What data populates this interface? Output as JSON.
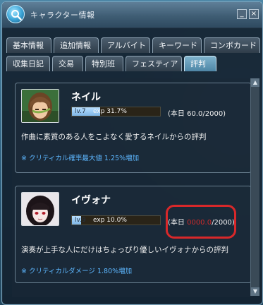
{
  "window": {
    "title": "キャラクター情報",
    "minimize_label": "_",
    "close_label": "×"
  },
  "tabs_row1": [
    "基本情報",
    "追加情報",
    "アルバイト",
    "キーワード",
    "コンボカード"
  ],
  "tabs_row2": [
    "収集日記",
    "交易",
    "特別班",
    "フェスティア",
    "評判"
  ],
  "active_tab_row2": 4,
  "characters": [
    {
      "name": "ネイル",
      "level": "lv.7",
      "exp": "exp 31.7%",
      "exp_fraction": 0.317,
      "today_prefix": "(本日 ",
      "today_value": "60.0",
      "today_suffix": "/2000)",
      "description": "作曲に素質のある人をこよなく愛するネイルからの評判",
      "bonus": "※ クリティカル確率最大値 1.25%増加"
    },
    {
      "name": "イヴォナ",
      "level": "lv.9",
      "exp": "exp 10.0%",
      "exp_fraction": 0.1,
      "today_prefix": "(本日 ",
      "today_value": "0000.0",
      "today_suffix": "/2000)",
      "description": "演奏が上手な人にだけはちょっぴり優しいイヴォナからの評判",
      "bonus": "※ クリティカルダメージ 1.80%増加"
    }
  ],
  "colors": {
    "accent_blue": "#5db7ff",
    "highlight_red": "#d8282a"
  },
  "icons": {
    "title": "magnifier-icon",
    "scroll_up": "triangle-up-icon",
    "scroll_down": "triangle-down-icon"
  }
}
